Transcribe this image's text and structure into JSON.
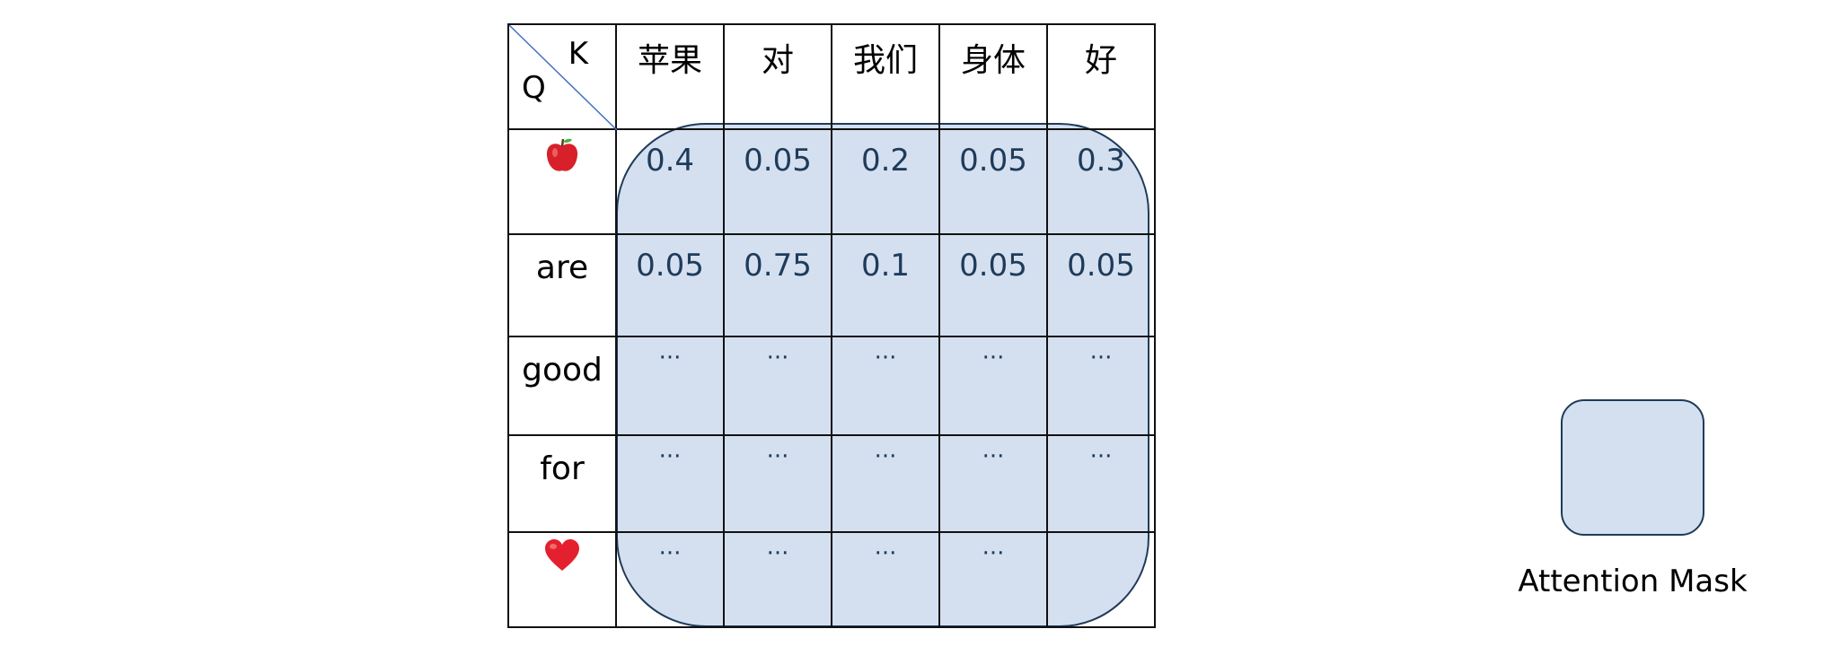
{
  "header": {
    "corner_k": "K",
    "corner_q": "Q",
    "keys": [
      "苹果",
      "对",
      "我们",
      "身体",
      "好"
    ]
  },
  "rows": [
    {
      "query_icon": "apple-icon",
      "values": [
        "0.4",
        "0.05",
        "0.2",
        "0.05",
        "0.3"
      ]
    },
    {
      "query": "are",
      "values": [
        "0.05",
        "0.75",
        "0.1",
        "0.05",
        "0.05"
      ]
    },
    {
      "query": "good",
      "values": [
        "···",
        "···",
        "···",
        "···",
        "···"
      ]
    },
    {
      "query": "for",
      "values": [
        "···",
        "···",
        "···",
        "···",
        "···"
      ]
    },
    {
      "query_icon": "heart-icon",
      "values": [
        "···",
        "···",
        "···",
        "···",
        ""
      ]
    }
  ],
  "legend": {
    "label": "Attention Mask",
    "color": "#d4e0f0",
    "border": "#1f3b5a"
  }
}
